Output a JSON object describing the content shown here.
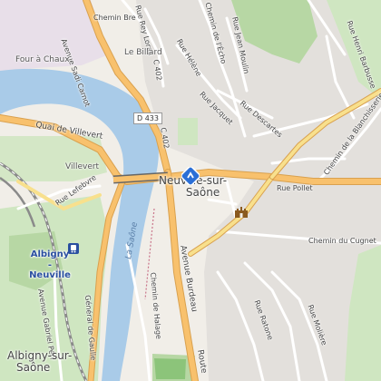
{
  "colors": {
    "land": "#f1eee8",
    "water": "#a9cbe8",
    "park": "#cfe6c1",
    "wood": "#b7d7a4",
    "residential": "#e3e0dc",
    "campus": "#e8dfe9",
    "main_road": "#f8c16d",
    "road": "#ffffff",
    "rail": "#8a8a8a",
    "poi_blue": "#2b6fd6"
  },
  "labels": {
    "chemin_bretto": "Chemin Bre",
    "avenue_sadi_carnot": "Avenue Sadi Carnot",
    "rue_rey_loras": "Rue Rey Loras",
    "chemin_echo": "Chemin de l'Écho",
    "rue_jean_moulin": "Rue Jean Moulin",
    "rue_henri_barbusse": "Rue Henri Barbusse",
    "four_a_chaux": "Four à Chaux",
    "le_billard": "Le Billard",
    "c402_top": "C 402",
    "rue_helene": "Rue Hélène",
    "rue_jacquet": "Rue Jacquet",
    "rue_descartes": "Rue Descartes",
    "d433": "D 433",
    "c402_mid": "C 402",
    "quai_villevert": "Quai de Villevert",
    "villevert": "Villevert",
    "rue_lefebvre": "Rue Lefebvre",
    "neuville": "Neuville-sur-Saône",
    "neuville_line1": "Neuville-sur-",
    "neuville_line2": "Saône",
    "rue_pollet": "Rue Pollet",
    "chemin_blanchisserie": "Chemin de la Blanchisserie",
    "albigny_station": "Albigny - Neuville",
    "chemin_cugnet": "Chemin du Cugnet",
    "la_saone": "La Saône",
    "chemin_halage": "Chemin de Halage",
    "avenue_burdeau": "Avenue Burdeau",
    "avenue_gabriel_peri": "Avenue Gabriel Péri",
    "general_de_gaulle": "Général de Gaulle",
    "rue_ratone": "Rue Ratone",
    "rue_moliere": "Rue Molière",
    "albigny_line1": "Albigny-sur-",
    "albigny_line2": "Saône",
    "route": "Route"
  },
  "icons": {
    "poi_pin": "tourism-info-pin-icon",
    "monument": "castle-monument-icon",
    "station": "train-station-icon"
  }
}
